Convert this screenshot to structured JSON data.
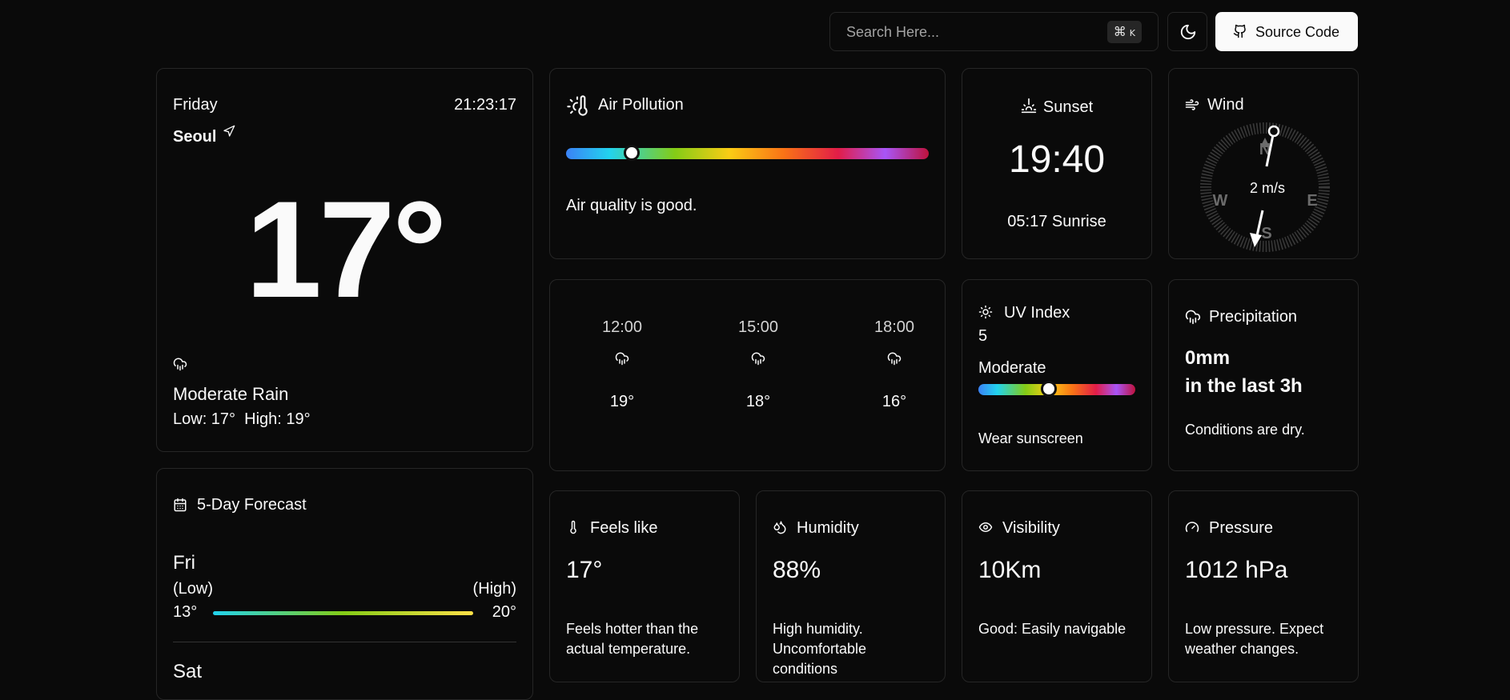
{
  "topbar": {
    "search_placeholder": "Search Here...",
    "shortcut_symbol": "⌘",
    "shortcut_key": "K",
    "source_label": "Source Code"
  },
  "current": {
    "day": "Friday",
    "time": "21:23:17",
    "city": "Seoul",
    "temperature": "17°",
    "condition": "Moderate Rain",
    "low": "Low: 17°",
    "high": "High: 19°"
  },
  "air_pollution": {
    "title": "Air Pollution",
    "message": "Air quality is good.",
    "level": 0.18
  },
  "sunset": {
    "title": "Sunset",
    "time": "19:40",
    "sunrise": "05:17 Sunrise"
  },
  "wind": {
    "title": "Wind",
    "speed": "2 m/s",
    "directions": {
      "n": "N",
      "e": "E",
      "s": "S",
      "w": "W"
    }
  },
  "hourly": [
    {
      "time": "12:00",
      "temp": "19°",
      "icon": "rain-icon"
    },
    {
      "time": "15:00",
      "temp": "18°",
      "icon": "rain-icon"
    },
    {
      "time": "18:00",
      "temp": "16°",
      "icon": "rain-icon"
    }
  ],
  "uv": {
    "title": "UV Index",
    "value": "5",
    "level_label": "Moderate",
    "advice": "Wear sunscreen",
    "level": 0.45
  },
  "precipitation": {
    "title": "Precipitation",
    "amount": "0mm",
    "period": "in the last 3h",
    "note": "Conditions are dry."
  },
  "forecast": {
    "title": "5-Day Forecast",
    "days": [
      {
        "day": "Fri",
        "low_label": "(Low)",
        "high_label": "(High)",
        "low": "13°",
        "high": "20°"
      },
      {
        "day": "Sat"
      }
    ]
  },
  "feels_like": {
    "title": "Feels like",
    "value": "17°",
    "note": "Feels hotter than the actual temperature."
  },
  "humidity": {
    "title": "Humidity",
    "value": "88%",
    "note": "High humidity. Uncomfortable conditions"
  },
  "visibility": {
    "title": "Visibility",
    "value": "10Km",
    "note": "Good: Easily navigable"
  },
  "pressure": {
    "title": "Pressure",
    "value": "1012 hPa",
    "note": "Low pressure. Expect weather changes."
  }
}
